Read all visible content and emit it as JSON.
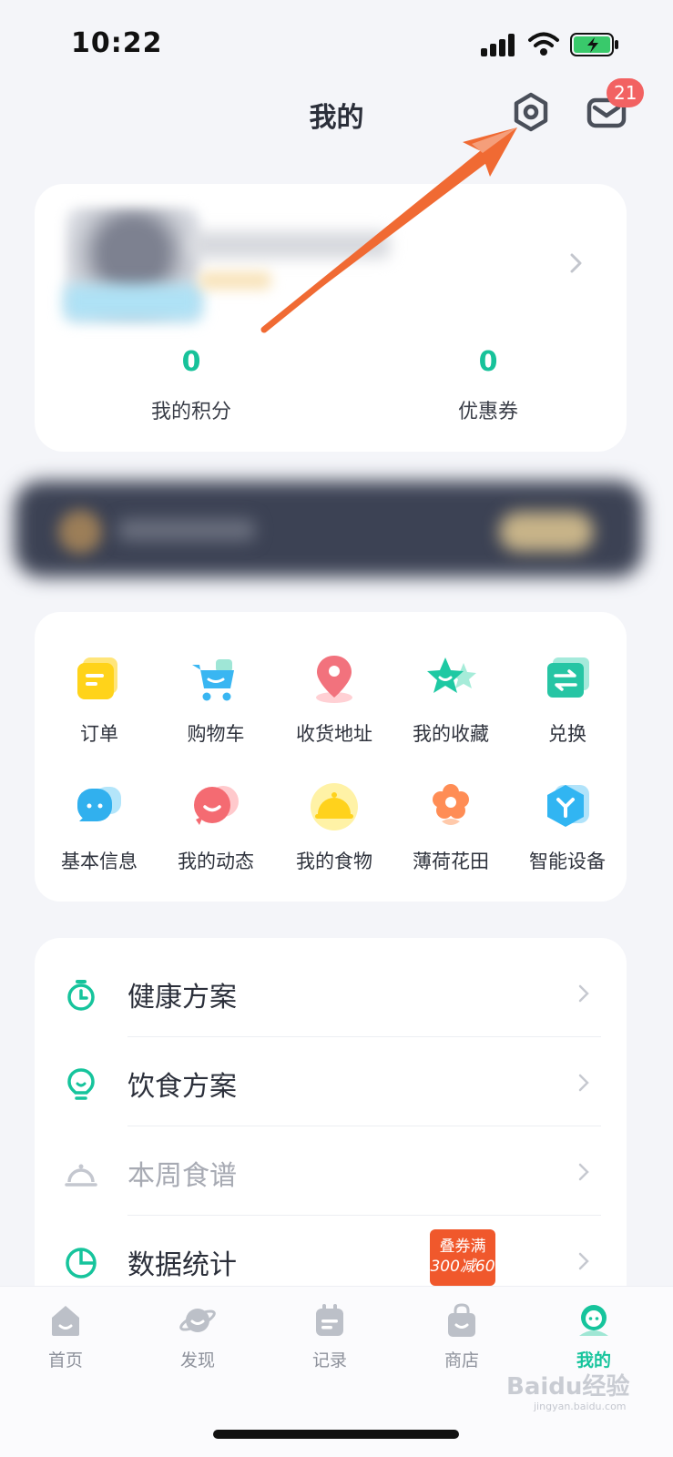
{
  "status_bar": {
    "time": "10:22"
  },
  "header": {
    "title": "我的",
    "mail_badge": "21"
  },
  "profile": {
    "points_value": "0",
    "points_label": "我的积分",
    "coupons_value": "0",
    "coupons_label": "优惠券"
  },
  "shortcuts": [
    {
      "label": "订单",
      "icon": "order-icon",
      "color": "#ffd31a"
    },
    {
      "label": "购物车",
      "icon": "cart-icon",
      "color": "#39b6f2"
    },
    {
      "label": "收货地址",
      "icon": "location-pin-icon",
      "color": "#f2727d"
    },
    {
      "label": "我的收藏",
      "icon": "star-icon",
      "color": "#1ec9a3"
    },
    {
      "label": "兑换",
      "icon": "exchange-icon",
      "color": "#26c5a4"
    },
    {
      "label": "基本信息",
      "icon": "profile-bubble-icon",
      "color": "#31b0ee"
    },
    {
      "label": "我的动态",
      "icon": "smile-bubble-icon",
      "color": "#f46b72"
    },
    {
      "label": "我的食物",
      "icon": "food-cloche-icon",
      "color": "#ffd21c"
    },
    {
      "label": "薄荷花田",
      "icon": "flower-icon",
      "color": "#ff8d55"
    },
    {
      "label": "智能设备",
      "icon": "smart-device-icon",
      "color": "#31b5f2"
    }
  ],
  "menu": [
    {
      "label": "健康方案",
      "icon": "timer-icon"
    },
    {
      "label": "饮食方案",
      "icon": "lightbulb-icon"
    },
    {
      "label": "本周食谱",
      "icon": "cloche-icon"
    },
    {
      "label": "数据统计",
      "icon": "pie-chart-icon"
    }
  ],
  "promo": {
    "line1": "叠券满",
    "line2": "300减60"
  },
  "tabs": [
    {
      "label": "首页",
      "icon": "home-icon"
    },
    {
      "label": "发现",
      "icon": "planet-icon"
    },
    {
      "label": "记录",
      "icon": "calendar-icon"
    },
    {
      "label": "商店",
      "icon": "shopping-bag-icon"
    },
    {
      "label": "我的",
      "icon": "me-icon",
      "active": true
    }
  ],
  "colors": {
    "accent": "#16c49c",
    "arrow": "#f06a33",
    "badge": "#f26262"
  },
  "watermark": {
    "brand": "Baidu经验",
    "url": "jingyan.baidu.com"
  }
}
